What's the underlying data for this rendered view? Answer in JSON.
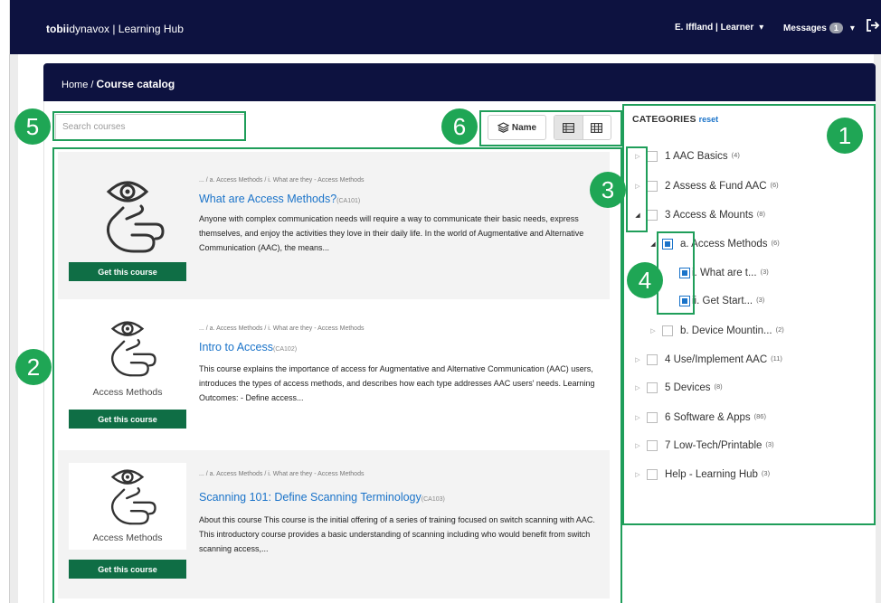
{
  "header": {
    "brand_bold": "tobii",
    "brand_rest": "dynavox | Learning Hub",
    "user_label": "E. Iffland | Learner",
    "messages_label": "Messages",
    "messages_count": "1"
  },
  "breadcrumb": {
    "home": "Home /",
    "current": "Course catalog"
  },
  "search": {
    "placeholder": "Search courses"
  },
  "toolbar": {
    "sort_label": "Name"
  },
  "courses": [
    {
      "crumbs": "... / a. Access Methods / i. What are they - Access Methods",
      "title": "What are Access Methods?",
      "code": "(CA101)",
      "desc": "Anyone with complex communication needs will require a way to communicate their basic needs, express themselves, and enjoy the activities they love in their daily life. In the world of Augmentative and Alternative Communication (AAC), the means...",
      "button": "Get this course",
      "image_label": ""
    },
    {
      "crumbs": "... / a. Access Methods / i. What are they - Access Methods",
      "title": "Intro to Access",
      "code": "(CA102)",
      "desc": "This course explains the importance of access for Augmentative and Alternative Communication (AAC) users, introduces the types of access methods, and describes how each type addresses AAC users' needs. Learning Outcomes: - Define access...",
      "button": "Get this course",
      "image_label": "Access Methods"
    },
    {
      "crumbs": "... / a. Access Methods / i. What are they - Access Methods",
      "title": "Scanning 101: Define Scanning Terminology",
      "code": "(CA103)",
      "desc": "About this course This course is the initial offering of a series of training focused on switch scanning with AAC. This introductory course provides a basic understanding of scanning including who would benefit from switch scanning access,...",
      "button": "Get this course",
      "image_label": "Access Methods"
    }
  ],
  "categories": {
    "heading": "CATEGORIES",
    "reset": "reset",
    "items": [
      {
        "label": "1 AAC Basics",
        "count": "(4)"
      },
      {
        "label": "2 Assess & Fund AAC",
        "count": "(6)"
      },
      {
        "label": "3 Access & Mounts",
        "count": "(8)"
      },
      {
        "label": "a. Access Methods",
        "count": "(6)"
      },
      {
        "label": "i. What are t...",
        "count": "(3)"
      },
      {
        "label": "ii. Get Start...",
        "count": "(3)"
      },
      {
        "label": "b. Device Mountin...",
        "count": "(2)"
      },
      {
        "label": "4 Use/Implement AAC",
        "count": "(11)"
      },
      {
        "label": "5 Devices",
        "count": "(8)"
      },
      {
        "label": "6 Software & Apps",
        "count": "(86)"
      },
      {
        "label": "7 Low-Tech/Printable",
        "count": "(3)"
      },
      {
        "label": "Help - Learning Hub",
        "count": "(3)"
      }
    ]
  },
  "callouts": [
    "1",
    "2",
    "3",
    "4",
    "5",
    "6"
  ],
  "colors": {
    "navy": "#0d1240",
    "green": "#0f6e45",
    "link": "#1a73c9",
    "callout": "#1fa655"
  }
}
